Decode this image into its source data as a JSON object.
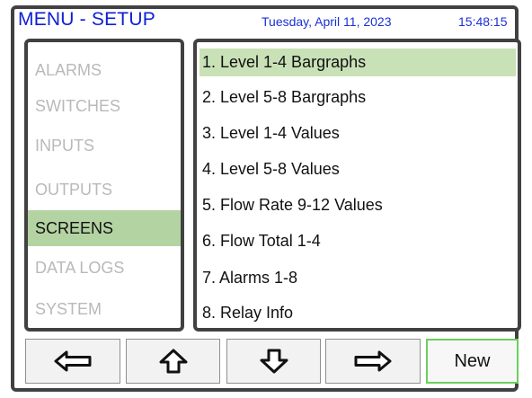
{
  "header": {
    "title": "MENU - SETUP",
    "date": "Tuesday, April 11, 2023",
    "time": "15:48:15"
  },
  "menu": {
    "items": [
      {
        "label": "ALARMS"
      },
      {
        "label": "SWITCHES"
      },
      {
        "label": "INPUTS"
      },
      {
        "label": "OUTPUTS"
      },
      {
        "label": "SCREENS",
        "selected": true
      },
      {
        "label": "DATA LOGS"
      },
      {
        "label": "SYSTEM"
      }
    ]
  },
  "screen_list": {
    "items": [
      {
        "label": "1. Level 1-4 Bargraphs",
        "selected": true
      },
      {
        "label": "2. Level 5-8 Bargraphs"
      },
      {
        "label": "3. Level 1-4 Values"
      },
      {
        "label": "4. Level 5-8 Values"
      },
      {
        "label": "5. Flow Rate 9-12 Values"
      },
      {
        "label": "6. Flow Total 1-4"
      },
      {
        "label": "7. Alarms 1-8"
      },
      {
        "label": "8. Relay Info"
      }
    ]
  },
  "buttons": {
    "back_icon": "arrow-left-icon",
    "up_icon": "arrow-up-icon",
    "down_icon": "arrow-down-icon",
    "forward_icon": "arrow-right-icon",
    "new_label": "New"
  },
  "colors": {
    "header_text": "#1b2fd8",
    "selected_menu_bg": "#b4d3a2",
    "selected_list_bg": "#c9e1b6",
    "disabled_text": "#b9b9b9",
    "new_button_border": "#6ad05c"
  }
}
